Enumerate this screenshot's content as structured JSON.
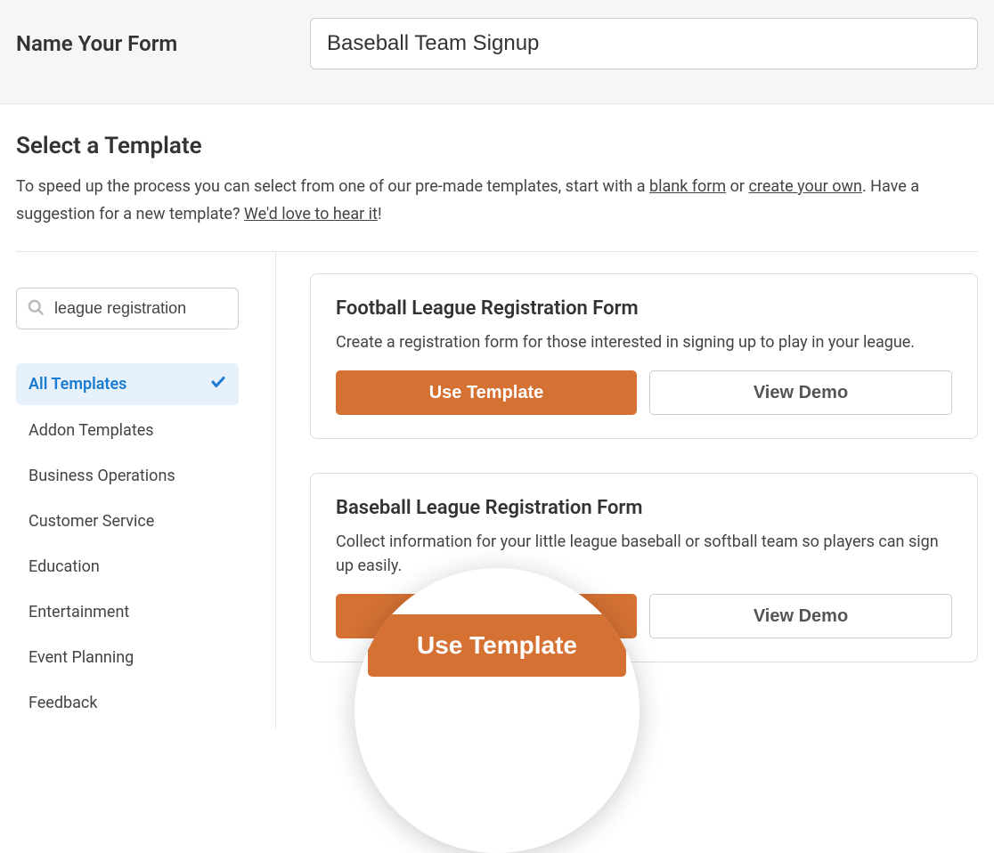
{
  "header": {
    "label": "Name Your Form",
    "value": "Baseball Team Signup"
  },
  "intro": {
    "title": "Select a Template",
    "desc_prefix": "To speed up the process you can select from one of our pre-made templates, start with a ",
    "link_blank": "blank form",
    "desc_mid1": " or ",
    "link_create": "create your own",
    "desc_mid2": ". Have a suggestion for a new template? ",
    "link_hear": "We'd love to hear it",
    "desc_suffix": "!"
  },
  "search": {
    "value": "league registration"
  },
  "categories": [
    {
      "label": "All Templates",
      "active": true
    },
    {
      "label": "Addon Templates",
      "active": false
    },
    {
      "label": "Business Operations",
      "active": false
    },
    {
      "label": "Customer Service",
      "active": false
    },
    {
      "label": "Education",
      "active": false
    },
    {
      "label": "Entertainment",
      "active": false
    },
    {
      "label": "Event Planning",
      "active": false
    },
    {
      "label": "Feedback",
      "active": false
    }
  ],
  "templates": [
    {
      "title": "Football League Registration Form",
      "desc": "Create a registration form for those interested in signing up to play in your league.",
      "use_label": "Use Template",
      "demo_label": "View Demo"
    },
    {
      "title": "Baseball League Registration Form",
      "desc": "Collect information for your little league baseball or softball team so players can sign up easily.",
      "use_label": "Use Template",
      "demo_label": "View Demo"
    }
  ],
  "lens": {
    "label": "Use Template"
  }
}
